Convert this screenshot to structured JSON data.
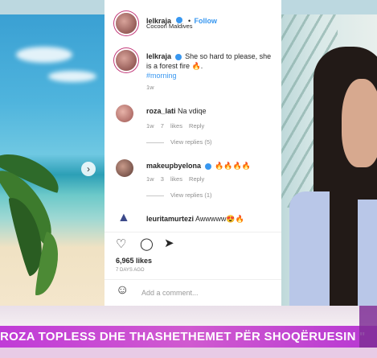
{
  "post": {
    "author": "lelkraja",
    "follow_label": "Follow",
    "location": "Cocoon Maldives",
    "likes": "6,965 likes",
    "time_ago": "7 DAYS AGO",
    "add_comment_placeholder": "Add a comment..."
  },
  "comments": [
    {
      "user": "lelkraja",
      "text": "She so hard to please, she is a forest fire 🔥.",
      "hashtag": "#morning",
      "time": "1w"
    },
    {
      "user": "roza_lati",
      "text": "Na vdiqe",
      "time": "1w",
      "likes": "7 likes",
      "reply": "Reply",
      "view_replies": "View replies (5)"
    },
    {
      "user": "makeupbyelona",
      "text": "🔥🔥🔥🔥",
      "time": "1w",
      "likes": "3 likes",
      "reply": "Reply",
      "view_replies": "View replies (1)"
    },
    {
      "user": "leuritamurtezi",
      "text": "Awwwww😍🔥",
      "time": "",
      "likes": "",
      "reply": "",
      "view_replies": ""
    }
  ],
  "ticker": {
    "text": "ROZA TOPLESS DHE THASHETHEMET PËR SHOQËRUESIN \""
  },
  "icons": {
    "heart": "heart-icon",
    "comment": "comment-icon",
    "share": "share-icon",
    "emoji": "emoji-icon",
    "next": "chevron-right-icon"
  },
  "colors": {
    "ticker_bg": "#c03bd7",
    "link_blue": "#3897f0",
    "verified_blue": "#3897f0"
  }
}
